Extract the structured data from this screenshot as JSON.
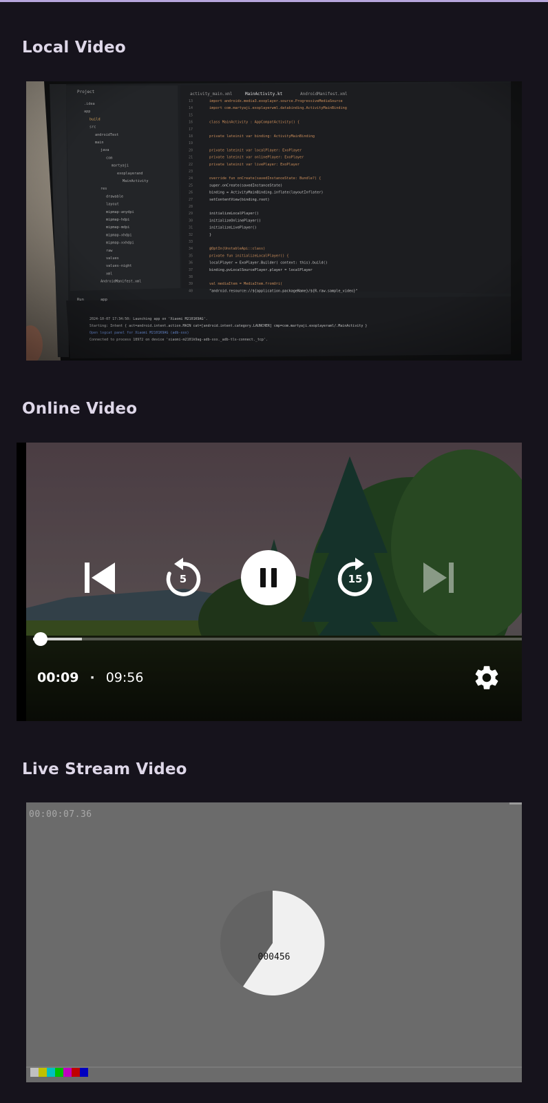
{
  "sections": {
    "local": {
      "title": "Local Video"
    },
    "online": {
      "title": "Online Video",
      "position": "00:09",
      "separator": "·",
      "duration": "09:56",
      "progress_fraction": 0.015,
      "buffered_fraction": 0.1,
      "controls": {
        "prev_icon": "skip-previous-icon",
        "rewind_icon": "replay-5-icon",
        "rewind_label": "5",
        "play_pause_icon": "pause-icon",
        "forward_icon": "forward-15-icon",
        "forward_label": "15",
        "next_icon": "skip-next-icon",
        "settings_icon": "gear-icon"
      }
    },
    "live": {
      "title": "Live Stream Video",
      "timestamp": "00:00:07.36",
      "counter": "000456",
      "color_bar": [
        "#c0c0c0",
        "#c0c000",
        "#00c0c0",
        "#00c000",
        "#c000c0",
        "#c00000",
        "#0000c0"
      ]
    }
  },
  "ide": {
    "tabs": [
      "activity_main.xml",
      "MainActivity.kt",
      "AndroidManifest.xml"
    ],
    "project_label": "Project",
    "tree": [
      ".idea",
      "app",
      "build",
      "src",
      "androidTest",
      "main",
      "java",
      "com",
      "martyaji",
      "exoplayerand",
      "MainActivity",
      "res",
      "drawable",
      "layout",
      "mipmap-anydpi",
      "mipmap-hdpi",
      "mipmap-mdpi",
      "mipmap-xhdpi",
      "mipmap-xxhdpi",
      "raw",
      "values",
      "values-night",
      "xml",
      "AndroidManifest.xml"
    ],
    "code": [
      "import androidx.media3.exoplayer.source.ProgressiveMediaSource",
      "import com.martyaji.exoplayerwml.databinding.ActivityMainBinding",
      "",
      "class MainActivity : AppCompatActivity() {",
      "",
      "    private lateinit var binding: ActivityMainBinding",
      "",
      "    private lateinit var localPlayer: ExoPlayer",
      "    private lateinit var onlinePlayer: ExoPlayer",
      "    private lateinit var livePlayer: ExoPlayer",
      "",
      "    override fun onCreate(savedInstanceState: Bundle?) {",
      "        super.onCreate(savedInstanceState)",
      "        binding = ActivityMainBinding.inflate(layoutInflater)",
      "        setContentView(binding.root)",
      "",
      "        initializeLocalPlayer()",
      "        initializeOnlinePlayer()",
      "        initializeLivePlayer()",
      "    }",
      "",
      "    @OptIn(UnstableApi::class)",
      "    private fun initializeLocalPlayer() {",
      "        localPlayer = ExoPlayer.Builder( context: this).build()",
      "        binding.pvLocalSourcePlayer.player = localPlayer",
      "",
      "        val mediaItem = MediaItem.fromUri(",
      "            \"android.resource://${application.packageName}/${R.raw.sample_video}\""
    ],
    "line_numbers": [
      "13",
      "14",
      "15",
      "16",
      "17",
      "18",
      "19",
      "20",
      "21",
      "22",
      "23",
      "24",
      "25",
      "26",
      "27",
      "28",
      "29",
      "30",
      "31",
      "32",
      "33",
      "34",
      "35",
      "36",
      "37",
      "38",
      "39",
      "40"
    ],
    "run_tab": "Run",
    "run_app": "app",
    "log": [
      "2024-10-07 17:34:50: Launching app on 'Xiaomi M2101K9AG'.",
      "Starting: Intent { act=android.intent.action.MAIN cat=[android.intent.category.LAUNCHER] cmp=com.martyaji.exoplayeraml/.MainActivity }",
      "Open logcat panel for Xiaomi M2101K9AG (adb-xxx)",
      "Connected to process 18972 on device 'xiaomi-m2101k9ag-adb-xxx._adb-tls-connect._tcp'."
    ]
  }
}
